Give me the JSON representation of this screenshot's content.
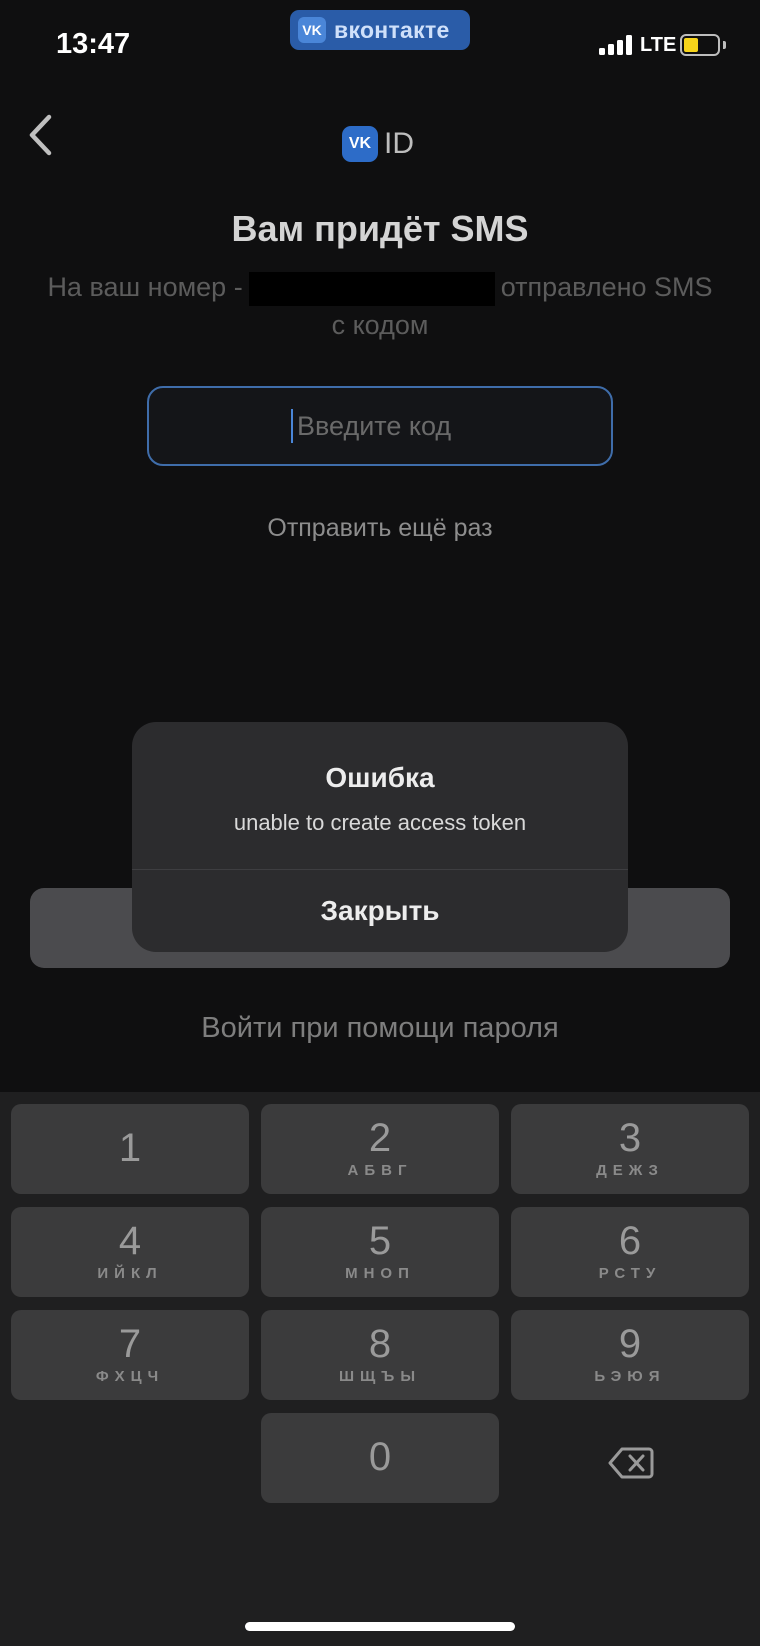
{
  "status_bar": {
    "time": "13:47",
    "app_pill": "вконтакте",
    "app_pill_logo": "VK",
    "network": "LTE",
    "battery_level_percent": 45,
    "battery_color": "#f6d41a"
  },
  "header": {
    "back_icon": "chevron-left-icon",
    "logo_mark": "VK",
    "logo_text": "ID"
  },
  "main": {
    "title": "Вам придёт SMS",
    "subtitle_before": "На ваш номер -",
    "subtitle_after": "отправлено SMS",
    "subtitle_line2": "с кодом",
    "code_input": {
      "value": "",
      "placeholder": "Введите код"
    },
    "resend_label": "Отправить ещё раз",
    "password_login_label": "Войти при помощи пароля"
  },
  "alert": {
    "title": "Ошибка",
    "message": "unable to create access token",
    "close_label": "Закрыть"
  },
  "keypad": {
    "keys": [
      {
        "digit": "1",
        "letters": ""
      },
      {
        "digit": "2",
        "letters": "АБВГ"
      },
      {
        "digit": "3",
        "letters": "ДЕЖЗ"
      },
      {
        "digit": "4",
        "letters": "ИЙКЛ"
      },
      {
        "digit": "5",
        "letters": "МНОП"
      },
      {
        "digit": "6",
        "letters": "РСТУ"
      },
      {
        "digit": "7",
        "letters": "ФХЦЧ"
      },
      {
        "digit": "8",
        "letters": "ШЩЪЫ"
      },
      {
        "digit": "9",
        "letters": "ЬЭЮЯ"
      },
      {
        "digit": "0",
        "letters": ""
      }
    ],
    "delete_icon": "backspace-icon"
  },
  "colors": {
    "accent": "#2d6cc8",
    "background": "#0f0f10",
    "alert_background": "#2c2c2e"
  }
}
